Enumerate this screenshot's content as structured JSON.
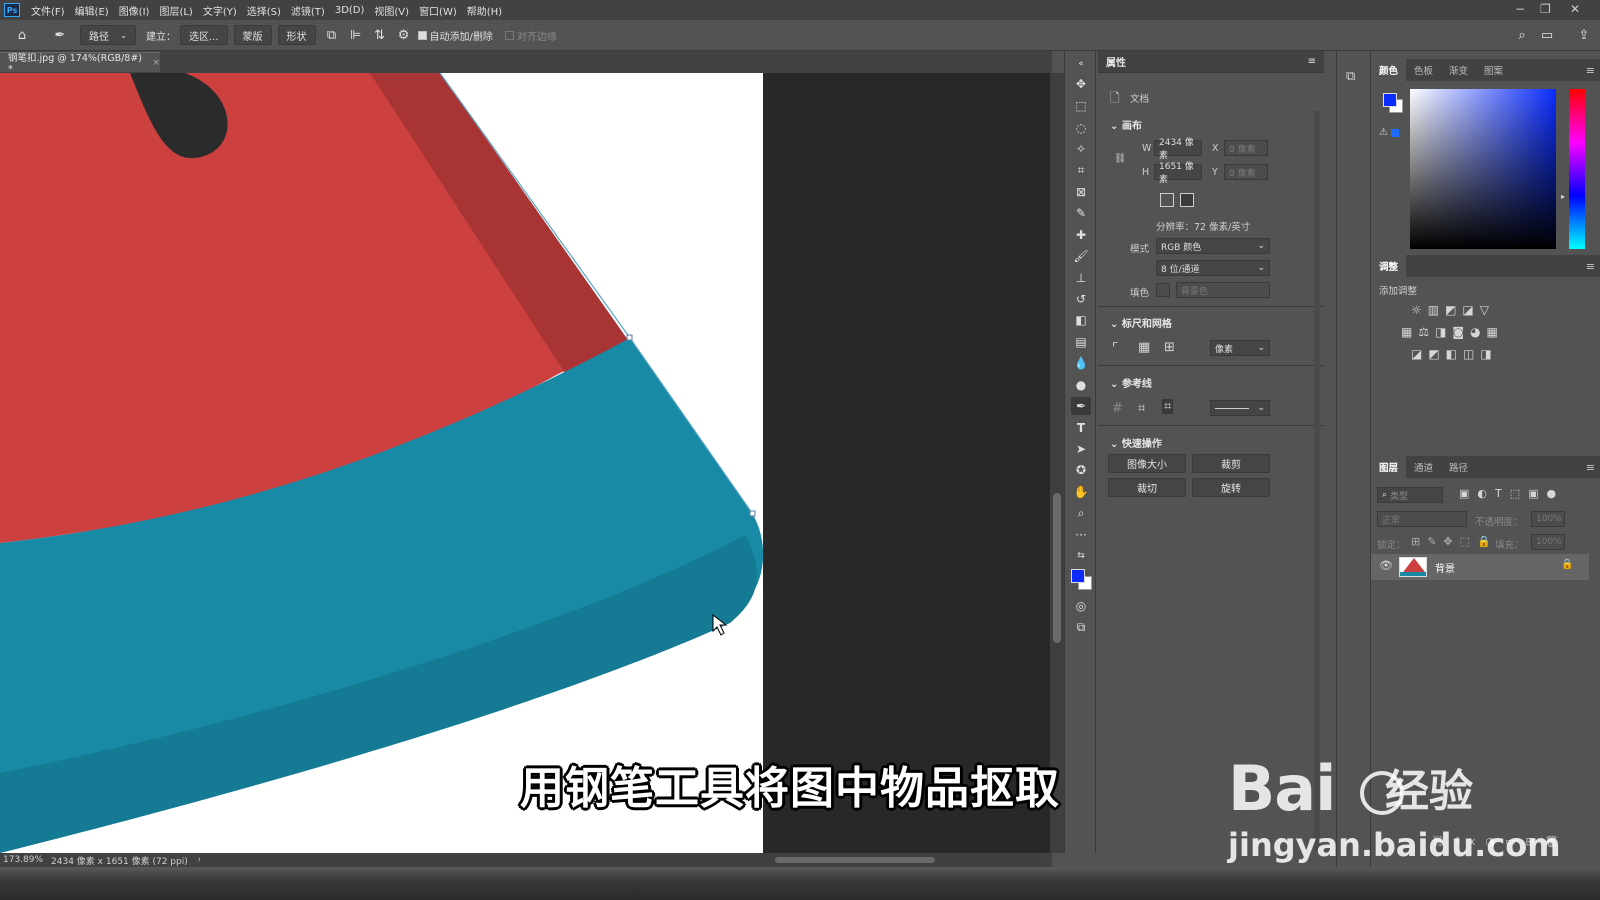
{
  "app": {
    "logo": "Ps"
  },
  "menu": [
    "文件(F)",
    "编辑(E)",
    "图像(I)",
    "图层(L)",
    "文字(Y)",
    "选择(S)",
    "滤镜(T)",
    "3D(D)",
    "视图(V)",
    "窗口(W)",
    "帮助(H)"
  ],
  "options": {
    "mode": "路径",
    "make_label": "建立：",
    "selection_btn": "选区...",
    "mask_btn": "蒙版",
    "shape_btn": "形状",
    "auto_add": "自动添加/删除",
    "align_edges": "对齐边缘"
  },
  "tab": {
    "title": "钢笔扣.jpg @ 174%(RGB/8#) *"
  },
  "status": {
    "zoom": "173.89%",
    "doc_info": "2434 像素 x 1651 像素 (72 ppi)"
  },
  "properties": {
    "tab": "属性",
    "doc_label": "文档",
    "canvas_title": "画布",
    "w_label": "W",
    "w_value": "2434 像素",
    "h_label": "H",
    "h_value": "1651 像素",
    "x_label": "X",
    "x_value": "0 像素",
    "y_label": "Y",
    "y_value": "0 像素",
    "resolution": "分辨率：72 像素/英寸",
    "mode_label": "模式",
    "mode_value": "RGB 颜色",
    "depth_value": "8 位/通道",
    "fill_label": "填色",
    "fill_value": "背景色",
    "rulers_title": "标尺和网格",
    "units_value": "像素",
    "guides_title": "参考线",
    "quick_title": "快速操作",
    "btn_image_size": "图像大小",
    "btn_crop": "裁剪",
    "btn_trim": "裁切",
    "btn_rotate": "旋转"
  },
  "color_panel": {
    "tabs": [
      "颜色",
      "色板",
      "渐变",
      "图案"
    ],
    "fg": "#0a2cff",
    "bg": "#ffffff"
  },
  "adjust_panel": {
    "tab": "调整",
    "add_label": "添加调整"
  },
  "layers_panel": {
    "tabs": [
      "图层",
      "通道",
      "路径"
    ],
    "search_placeholder": "类型",
    "blend_mode": "正常",
    "opacity_label": "不透明度：",
    "opacity_value": "100%",
    "lock_label": "锁定：",
    "fill_label": "填充：",
    "fill_value": "100%",
    "layer_name": "背景"
  },
  "subtitle": "用钢笔工具将图中物品抠取",
  "watermark": {
    "brand": "Bai",
    "cn": "经验",
    "url": "jingyan.baidu.com"
  },
  "colors": {
    "red": "#cc4040",
    "dark_red": "#a83434",
    "teal": "#188aa6",
    "teal_dark": "#157a94",
    "panel": "#535353"
  }
}
